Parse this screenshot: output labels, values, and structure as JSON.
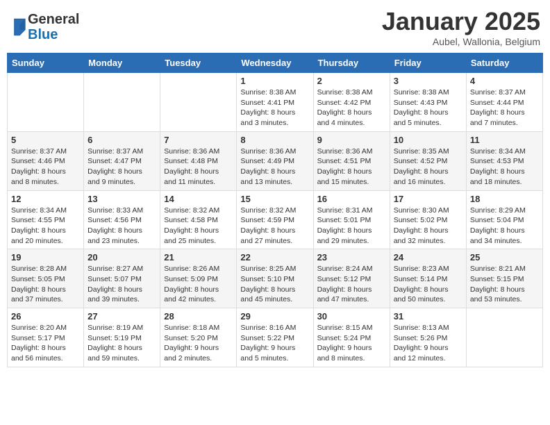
{
  "header": {
    "logo_general": "General",
    "logo_blue": "Blue",
    "month_title": "January 2025",
    "location": "Aubel, Wallonia, Belgium"
  },
  "days_of_week": [
    "Sunday",
    "Monday",
    "Tuesday",
    "Wednesday",
    "Thursday",
    "Friday",
    "Saturday"
  ],
  "weeks": [
    [
      {
        "day": null,
        "info": null
      },
      {
        "day": null,
        "info": null
      },
      {
        "day": null,
        "info": null
      },
      {
        "day": "1",
        "info": "Sunrise: 8:38 AM\nSunset: 4:41 PM\nDaylight: 8 hours and 3 minutes."
      },
      {
        "day": "2",
        "info": "Sunrise: 8:38 AM\nSunset: 4:42 PM\nDaylight: 8 hours and 4 minutes."
      },
      {
        "day": "3",
        "info": "Sunrise: 8:38 AM\nSunset: 4:43 PM\nDaylight: 8 hours and 5 minutes."
      },
      {
        "day": "4",
        "info": "Sunrise: 8:37 AM\nSunset: 4:44 PM\nDaylight: 8 hours and 7 minutes."
      }
    ],
    [
      {
        "day": "5",
        "info": "Sunrise: 8:37 AM\nSunset: 4:46 PM\nDaylight: 8 hours and 8 minutes."
      },
      {
        "day": "6",
        "info": "Sunrise: 8:37 AM\nSunset: 4:47 PM\nDaylight: 8 hours and 9 minutes."
      },
      {
        "day": "7",
        "info": "Sunrise: 8:36 AM\nSunset: 4:48 PM\nDaylight: 8 hours and 11 minutes."
      },
      {
        "day": "8",
        "info": "Sunrise: 8:36 AM\nSunset: 4:49 PM\nDaylight: 8 hours and 13 minutes."
      },
      {
        "day": "9",
        "info": "Sunrise: 8:36 AM\nSunset: 4:51 PM\nDaylight: 8 hours and 15 minutes."
      },
      {
        "day": "10",
        "info": "Sunrise: 8:35 AM\nSunset: 4:52 PM\nDaylight: 8 hours and 16 minutes."
      },
      {
        "day": "11",
        "info": "Sunrise: 8:34 AM\nSunset: 4:53 PM\nDaylight: 8 hours and 18 minutes."
      }
    ],
    [
      {
        "day": "12",
        "info": "Sunrise: 8:34 AM\nSunset: 4:55 PM\nDaylight: 8 hours and 20 minutes."
      },
      {
        "day": "13",
        "info": "Sunrise: 8:33 AM\nSunset: 4:56 PM\nDaylight: 8 hours and 23 minutes."
      },
      {
        "day": "14",
        "info": "Sunrise: 8:32 AM\nSunset: 4:58 PM\nDaylight: 8 hours and 25 minutes."
      },
      {
        "day": "15",
        "info": "Sunrise: 8:32 AM\nSunset: 4:59 PM\nDaylight: 8 hours and 27 minutes."
      },
      {
        "day": "16",
        "info": "Sunrise: 8:31 AM\nSunset: 5:01 PM\nDaylight: 8 hours and 29 minutes."
      },
      {
        "day": "17",
        "info": "Sunrise: 8:30 AM\nSunset: 5:02 PM\nDaylight: 8 hours and 32 minutes."
      },
      {
        "day": "18",
        "info": "Sunrise: 8:29 AM\nSunset: 5:04 PM\nDaylight: 8 hours and 34 minutes."
      }
    ],
    [
      {
        "day": "19",
        "info": "Sunrise: 8:28 AM\nSunset: 5:05 PM\nDaylight: 8 hours and 37 minutes."
      },
      {
        "day": "20",
        "info": "Sunrise: 8:27 AM\nSunset: 5:07 PM\nDaylight: 8 hours and 39 minutes."
      },
      {
        "day": "21",
        "info": "Sunrise: 8:26 AM\nSunset: 5:09 PM\nDaylight: 8 hours and 42 minutes."
      },
      {
        "day": "22",
        "info": "Sunrise: 8:25 AM\nSunset: 5:10 PM\nDaylight: 8 hours and 45 minutes."
      },
      {
        "day": "23",
        "info": "Sunrise: 8:24 AM\nSunset: 5:12 PM\nDaylight: 8 hours and 47 minutes."
      },
      {
        "day": "24",
        "info": "Sunrise: 8:23 AM\nSunset: 5:14 PM\nDaylight: 8 hours and 50 minutes."
      },
      {
        "day": "25",
        "info": "Sunrise: 8:21 AM\nSunset: 5:15 PM\nDaylight: 8 hours and 53 minutes."
      }
    ],
    [
      {
        "day": "26",
        "info": "Sunrise: 8:20 AM\nSunset: 5:17 PM\nDaylight: 8 hours and 56 minutes."
      },
      {
        "day": "27",
        "info": "Sunrise: 8:19 AM\nSunset: 5:19 PM\nDaylight: 8 hours and 59 minutes."
      },
      {
        "day": "28",
        "info": "Sunrise: 8:18 AM\nSunset: 5:20 PM\nDaylight: 9 hours and 2 minutes."
      },
      {
        "day": "29",
        "info": "Sunrise: 8:16 AM\nSunset: 5:22 PM\nDaylight: 9 hours and 5 minutes."
      },
      {
        "day": "30",
        "info": "Sunrise: 8:15 AM\nSunset: 5:24 PM\nDaylight: 9 hours and 8 minutes."
      },
      {
        "day": "31",
        "info": "Sunrise: 8:13 AM\nSunset: 5:26 PM\nDaylight: 9 hours and 12 minutes."
      },
      {
        "day": null,
        "info": null
      }
    ]
  ]
}
